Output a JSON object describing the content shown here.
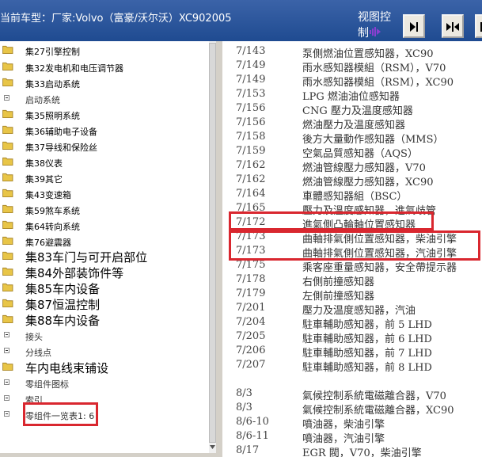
{
  "header": {
    "title": "当前车型：厂家:Volvo（富豪/沃尔沃）XC902005",
    "view_control_line1": "视图控",
    "view_control_line2": "制"
  },
  "tree": [
    {
      "type": "folder",
      "label": "集27引擎控制",
      "size": "small"
    },
    {
      "type": "folder",
      "label": "集32发电机和电压调节器",
      "size": "small"
    },
    {
      "type": "folder-open",
      "label": "集33启动系统",
      "size": "small"
    },
    {
      "type": "minus",
      "label": "启动系统",
      "size": "gray"
    },
    {
      "type": "folder",
      "label": "集35照明系统",
      "size": "small"
    },
    {
      "type": "folder",
      "label": "集36辅助电子设备",
      "size": "small"
    },
    {
      "type": "folder",
      "label": "集37导线和保险丝",
      "size": "small"
    },
    {
      "type": "folder",
      "label": "集38仪表",
      "size": "small"
    },
    {
      "type": "folder",
      "label": "集39其它",
      "size": "small"
    },
    {
      "type": "folder",
      "label": "集43变速箱",
      "size": "small"
    },
    {
      "type": "folder",
      "label": "集59煞车系统",
      "size": "small"
    },
    {
      "type": "folder",
      "label": "集64转向系统",
      "size": "small"
    },
    {
      "type": "folder",
      "label": "集76避震器",
      "size": "small"
    },
    {
      "type": "folder",
      "label": "集83车门与可开启部位",
      "size": "large"
    },
    {
      "type": "folder",
      "label": "集84外部装饰件等",
      "size": "large"
    },
    {
      "type": "folder",
      "label": "集85车内设备",
      "size": "large"
    },
    {
      "type": "folder",
      "label": "集87恒温控制",
      "size": "large"
    },
    {
      "type": "folder",
      "label": "集88车内设备",
      "size": "large"
    },
    {
      "type": "minus",
      "label": "接头",
      "size": "gray"
    },
    {
      "type": "minus",
      "label": "分线点",
      "size": "gray"
    },
    {
      "type": "folder",
      "label": "车内电线束铺设",
      "size": "large"
    },
    {
      "type": "minus",
      "label": "零组件图标",
      "size": "gray"
    },
    {
      "type": "minus",
      "label": "索引",
      "size": "gray"
    },
    {
      "type": "minus",
      "label": "零组件一览表1: 6",
      "size": "gray"
    }
  ],
  "components": [
    {
      "code": "7/143",
      "desc": "泵側燃油位置感知器，XC90"
    },
    {
      "code": "7/149",
      "desc": "雨水感知器模組（RSM），V70"
    },
    {
      "code": "7/149",
      "desc": "雨水感知器模組（RSM），XC90"
    },
    {
      "code": "7/153",
      "desc": "LPG 燃油油位感知器"
    },
    {
      "code": "7/156",
      "desc": "CNG 壓力及温度感知器"
    },
    {
      "code": "7/156",
      "desc": "燃油壓力及温度感知器"
    },
    {
      "code": "7/158",
      "desc": "後方大量動作感知器（MMS）"
    },
    {
      "code": "7/159",
      "desc": "空氣品質感知器（AQS）"
    },
    {
      "code": "7/162",
      "desc": "燃油管線壓力感知器，V70"
    },
    {
      "code": "7/162",
      "desc": "燃油管線壓力感知器，XC90"
    },
    {
      "code": "7/164",
      "desc": "車體感知器組（BSC）"
    },
    {
      "code": "7/165",
      "desc": "壓力及溫度感知器，進氣歧管"
    },
    {
      "code": "7/172",
      "desc": "進氣側凸輪軸位置感知器"
    },
    {
      "code": "7/173",
      "desc": "曲軸排氣側位置感知器，柴油引擎"
    },
    {
      "code": "7/173",
      "desc": "曲軸排氣側位置感知器，汽油引擎"
    },
    {
      "code": "7/175",
      "desc": "乘客座重量感知器，安全帶提示器"
    },
    {
      "code": "7/178",
      "desc": "右側前撞感知器"
    },
    {
      "code": "7/179",
      "desc": "左側前撞感知器"
    },
    {
      "code": "7/201",
      "desc": "壓力及温度感知器，汽油"
    },
    {
      "code": "7/204",
      "desc": "駐車輔助感知器，前 5 LHD"
    },
    {
      "code": "7/205",
      "desc": "駐車輔助感知器，前 6 LHD"
    },
    {
      "code": "7/206",
      "desc": "駐車輔助感知器，前 7 LHD"
    },
    {
      "code": "7/207",
      "desc": "駐車輔助感知器，前 8 LHD"
    },
    {
      "code": "8/3",
      "desc": "氣候控制系統電磁離合器，V70"
    },
    {
      "code": "8/3",
      "desc": "氣候控制系統電磁離合器，XC90"
    },
    {
      "code": "8/6-10",
      "desc": "噴油器，柴油引擎"
    },
    {
      "code": "8/6-11",
      "desc": "噴油器，汽油引擎"
    },
    {
      "code": "8/17",
      "desc": "EGR 閥，V70，柴油引擎"
    }
  ],
  "colors": {
    "highlight": "#d9272f",
    "header_bg": "#2a56a0",
    "folder": "#e8c547"
  }
}
